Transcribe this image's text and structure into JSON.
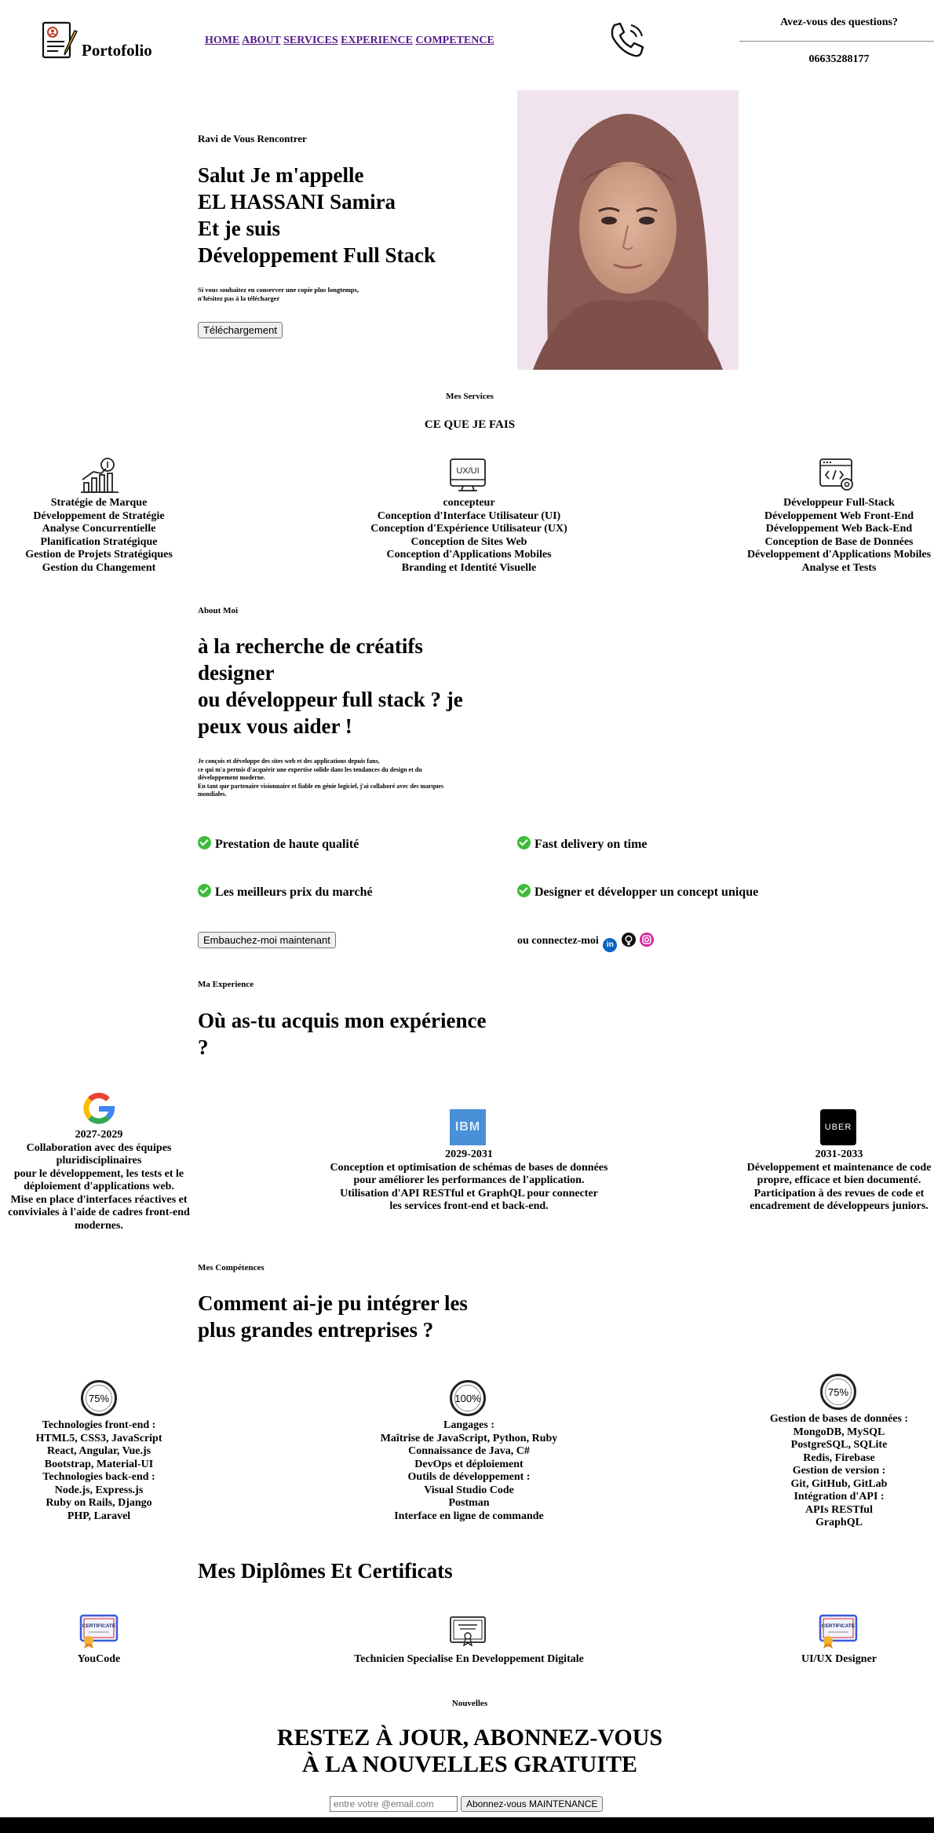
{
  "header": {
    "logo_text": "Portofolio",
    "nav": [
      "HOME",
      "ABOUT",
      "SERVICES",
      "EXPERIENCE",
      "COMPETENCE"
    ],
    "contact_question": "Avez-vous des questions?",
    "phone": "06635288177"
  },
  "hero": {
    "kicker": "Ravi de Vous Rencontrer",
    "title_lines": [
      "Salut Je m'appelle",
      "EL HASSANI Samira",
      "Et je suis",
      "Développement Full Stack"
    ],
    "note_lines": [
      "Si vous souhaitez en conserver une copie plus longtemps,",
      "n'hésitez pas à la télécharger"
    ],
    "download_label": "Téléchargement"
  },
  "services": {
    "kicker": "Mes Services",
    "title": "CE QUE JE FAIS",
    "cols": [
      {
        "icon": "growth-chart-icon",
        "lines": [
          "Stratégie de Marque",
          "Développement de Stratégie",
          "Analyse Concurrentielle",
          "Planification Stratégique",
          "Gestion de Projets Stratégiques",
          "Gestion du Changement"
        ]
      },
      {
        "icon": "ux-ui-icon",
        "icon_text": "UX/UI",
        "lines": [
          "concepteur",
          "Conception d'Interface Utilisateur (UI)",
          "Conception d'Expérience Utilisateur (UX)",
          "Conception de Sites Web",
          "Conception d'Applications Mobiles",
          "Branding et Identité Visuelle"
        ]
      },
      {
        "icon": "code-settings-icon",
        "lines": [
          "Développeur Full-Stack",
          "Développement Web Front-End",
          "Développement Web Back-End",
          "Conception de Base de Données",
          "Développement d'Applications Mobiles",
          "Analyse et Tests"
        ]
      }
    ]
  },
  "about": {
    "kicker": "About Moi",
    "title_lines": [
      "à la recherche de créatifs",
      "designer",
      "ou développeur full stack ? je",
      "peux vous aider !"
    ],
    "text_lines": [
      "Je conçois et développe des sites web et des applications depuis fans,",
      "ce qui m'a permis d'acquérir une expertise solide dans les tendances du design et du",
      "développement moderne.",
      "En tant que partenaire visionnaire et fiable en génie logiciel, j'ai collaboré avec des marques",
      "mondiales."
    ],
    "features": [
      "Prestation de haute qualité",
      "Fast delivery on time",
      "Les meilleurs prix du marché",
      "Designer et développer un concept unique"
    ],
    "hire_label": "Embauchez-moi maintenant",
    "connect_text": "ou connectez-moi"
  },
  "experience": {
    "kicker": "Ma Experience",
    "title_lines": [
      "Où as-tu acquis mon expérience",
      "?"
    ],
    "items": [
      {
        "logo": "google-logo",
        "years": "2027-2029",
        "lines": [
          "Collaboration avec des équipes",
          "pluridisciplinaires",
          "pour le développement, les tests et le",
          "déploiement d'applications web.",
          "Mise en place d'interfaces réactives et",
          "conviviales à l'aide de cadres front-end",
          "modernes."
        ]
      },
      {
        "logo": "ibm-logo",
        "logo_text": "IBM",
        "years": "2029-2031",
        "lines": [
          "Conception et optimisation de schémas de bases de données",
          "pour améliorer les performances de l'application.",
          "Utilisation d'API RESTful et GraphQL pour connecter",
          "les services front-end et back-end."
        ]
      },
      {
        "logo": "uber-logo",
        "logo_text": "UBER",
        "years": "2031-2033",
        "lines": [
          "Développement et maintenance de code",
          "propre, efficace et bien documenté.",
          "Participation à des revues de code et",
          "encadrement de développeurs juniors."
        ]
      }
    ]
  },
  "skills": {
    "kicker": "Mes Compétences",
    "title_lines": [
      "Comment ai-je pu intégrer les",
      "plus grandes entreprises ?"
    ],
    "cols": [
      {
        "percent": "75%",
        "percent_value": 75,
        "lines": [
          "Technologies front-end :",
          "HTML5, CSS3, JavaScript",
          "React, Angular, Vue.js",
          "Bootstrap, Material-UI",
          "Technologies back-end :",
          "Node.js, Express.js",
          "Ruby on Rails, Django",
          "PHP, Laravel"
        ]
      },
      {
        "percent": "100%",
        "percent_value": 100,
        "lines": [
          "Langages :",
          "Maîtrise de JavaScript, Python, Ruby",
          "Connaissance de Java, C#",
          "DevOps et déploiement",
          "Outils de développement :",
          "Visual Studio Code",
          "Postman",
          "Interface en ligne de commande"
        ]
      },
      {
        "percent": "75%",
        "percent_value": 75,
        "lines": [
          "Gestion de bases de données :",
          "MongoDB, MySQL",
          "PostgreSQL, SQLite",
          "Redis, Firebase",
          "Gestion de version :",
          "Git, GitHub, GitLab",
          "Intégration d'API :",
          "APIs RESTful",
          "GraphQL"
        ]
      }
    ]
  },
  "certs": {
    "title": "Mes Diplômes Et Certificats",
    "items": [
      {
        "icon": "certificate-icon",
        "badge_text": "CERTIFICATE",
        "label": "YouCode"
      },
      {
        "icon": "diploma-icon",
        "label": "Technicien Specialise En Developpement Digitale"
      },
      {
        "icon": "certificate-icon",
        "badge_text": "CERTIFICATE",
        "label": "UI/UX Designer"
      }
    ]
  },
  "news": {
    "kicker": "Nouvelles",
    "title_lines": [
      "RESTEZ À JOUR, ABONNEZ-VOUS",
      "À LA NOUVELLES GRATUITE"
    ],
    "email_placeholder": "entre votre @email.com",
    "subscribe_label": "Abonnez-vous MAINTENANCE"
  },
  "colors": {
    "link": "#551a8b",
    "check": "#3dbb3a",
    "linkedin": "#0a66c2",
    "instagram": "#d6249f",
    "ibm": "#4a90d9",
    "footer": "#000000"
  }
}
